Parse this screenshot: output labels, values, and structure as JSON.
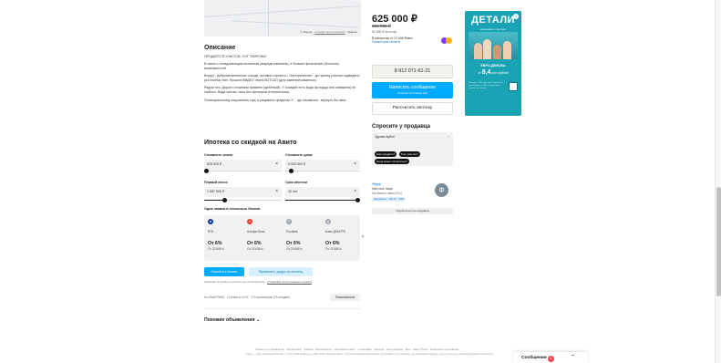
{
  "map": {
    "caption_prefix": "© Яндекс",
    "caption_link": "Условия использования",
    "caption_brand": "Яндекс"
  },
  "description": {
    "title": "Описание",
    "paragraphs": [
      "ПРОДАЕТСЯ УЧАСТОК, СНТ \"БЕРЕЗКА\".",
      "В связи с ненадлежащим оплатным (аккредитованием), в больше физических (болезнь) возможностей.",
      "Вокруг - доброжелательные соседи, активно строится / Электричество - до границ участка подведено (из столба) Мат. Прошли ВИДЕО через ВОТСАП (для заинтересованных).",
      "Рядом лес. Дороги отсыпаны гравием (щебенкой). У соседей есть вода (колодцы или скважина) не глубоко. Вода чистая, пока без фильтров (техническая).",
      "Потенциальному покупателю торг, в разумных пределах !!! ', где назовется - вернуть бы свое. '"
    ]
  },
  "mortgage": {
    "title": "Ипотека со скидкой на Авито",
    "land_cost_label": "Стоимость земли",
    "land_cost_value": "625 000 ₽",
    "house_cost_label": "Стоимость дома",
    "house_cost_value": "5 000 000 ₽",
    "down_payment_label": "Первый взнос",
    "down_payment_value": "1 687 500 ₽",
    "term_label": "Срок ипотеки",
    "term_value": "30 лет",
    "land_slider_level": 0,
    "house_slider_level": 0.05,
    "down_payment_slider_level": 0.25,
    "term_slider_level": 1,
    "clear_icon": "close-icon",
    "banks_title": "Одна заявка в несколько банков",
    "banks": [
      {
        "name": "ВТБ",
        "rate": "От 6%",
        "payment": "От 23 608 ₽",
        "logo_color": "#0a3a8c",
        "logo_icon": "vtb-logo-icon"
      },
      {
        "name": "Альфа-Банк",
        "rate": "От 6%",
        "payment": "От 23 608 ₽",
        "logo_color": "#ef3124",
        "logo_icon": "alfa-logo-icon"
      },
      {
        "name": "Росбанк",
        "rate": "От 6%",
        "payment": "От 23 608 ₽",
        "logo_color": "#9ba3ab",
        "logo_icon": "rosbank-logo-icon"
      },
      {
        "name": "Банк ДОМ.РФ",
        "rate": "От 6%",
        "payment": "От 23 608 ₽",
        "logo_color": "#9ba3ab",
        "logo_icon": "domrf-logo-icon"
      }
    ],
    "apply_button": "Перейти к анкете",
    "check_button": "Проверить, дадут ли ипотеку",
    "disclaimer_prefix": "Нажимая «Перейти к анкете» вы соглашаетесь с",
    "disclaimer_link": "условиями использования сервиса"
  },
  "listing_meta": {
    "info": "№ 4346375816 · 17 июля в 14:47 · 170 просмотров (+5 сегодня)",
    "complain_button": "Пожаловаться"
  },
  "similar": {
    "title": "Похожие объявления"
  },
  "sidebar": {
    "price": "625 000 ₽",
    "old_price": "650 000 ₽",
    "per_unit": "62 500 ₽ за сотку",
    "installment_text": "В рассрочку от 27 608 ₽/мес.",
    "installment_link": "Посмотреть оплаты",
    "phone": "8 912 071-61-21",
    "message_button": "Написать сообщение",
    "message_sub": "Отвечает в течение дня",
    "calc_button": "Рассчитать ипотеку",
    "ask_title": "Спросите у продавца",
    "chat_placeholder": "Здравствуйте!",
    "chips": [
      "Ещё продаёте?",
      "Торг уместен?",
      "Когда можно посмотреть?"
    ],
    "seller_type": "Фёдор",
    "seller_name": "Частное лицо",
    "seller_since": "На Авито с июня 2014",
    "seller_badge": "Документы · ФОТО · 2024",
    "seller_avatar_letter": "Ф",
    "subscribe_button": "Подписаться на продавца"
  },
  "ad": {
    "title": "ДЕТАЛИ",
    "subtitle": "евроремонт под ключ",
    "promo": "ЕВРО-ДВУШКА",
    "rate_prefix": "от",
    "rate_value": "8,4",
    "rate_suffix": "млн рублей",
    "fine_print": "Реклама. ООО «Детали». Проектная декларация на сайте. Подробные условия по ссылке."
  },
  "footer": {
    "links": "Разместить объявление · Объявления · Помощь · Безопасность · Реклама на сайте · О компании · Карьера · Авито Журнал · Блог · Авито Поиск · Мобильное приложение",
    "legal": "Авито — сайт объявлений России. © ООО «КЕХ еКоммерц» 2007–2024. Правила Авито. Политика конфиденциальности. Оплачивая услуги на Авито, вы принимаете оферту. Авито использует рекомендательные технологии."
  },
  "messages_bar": {
    "label": "Сообщения",
    "count": "6"
  }
}
